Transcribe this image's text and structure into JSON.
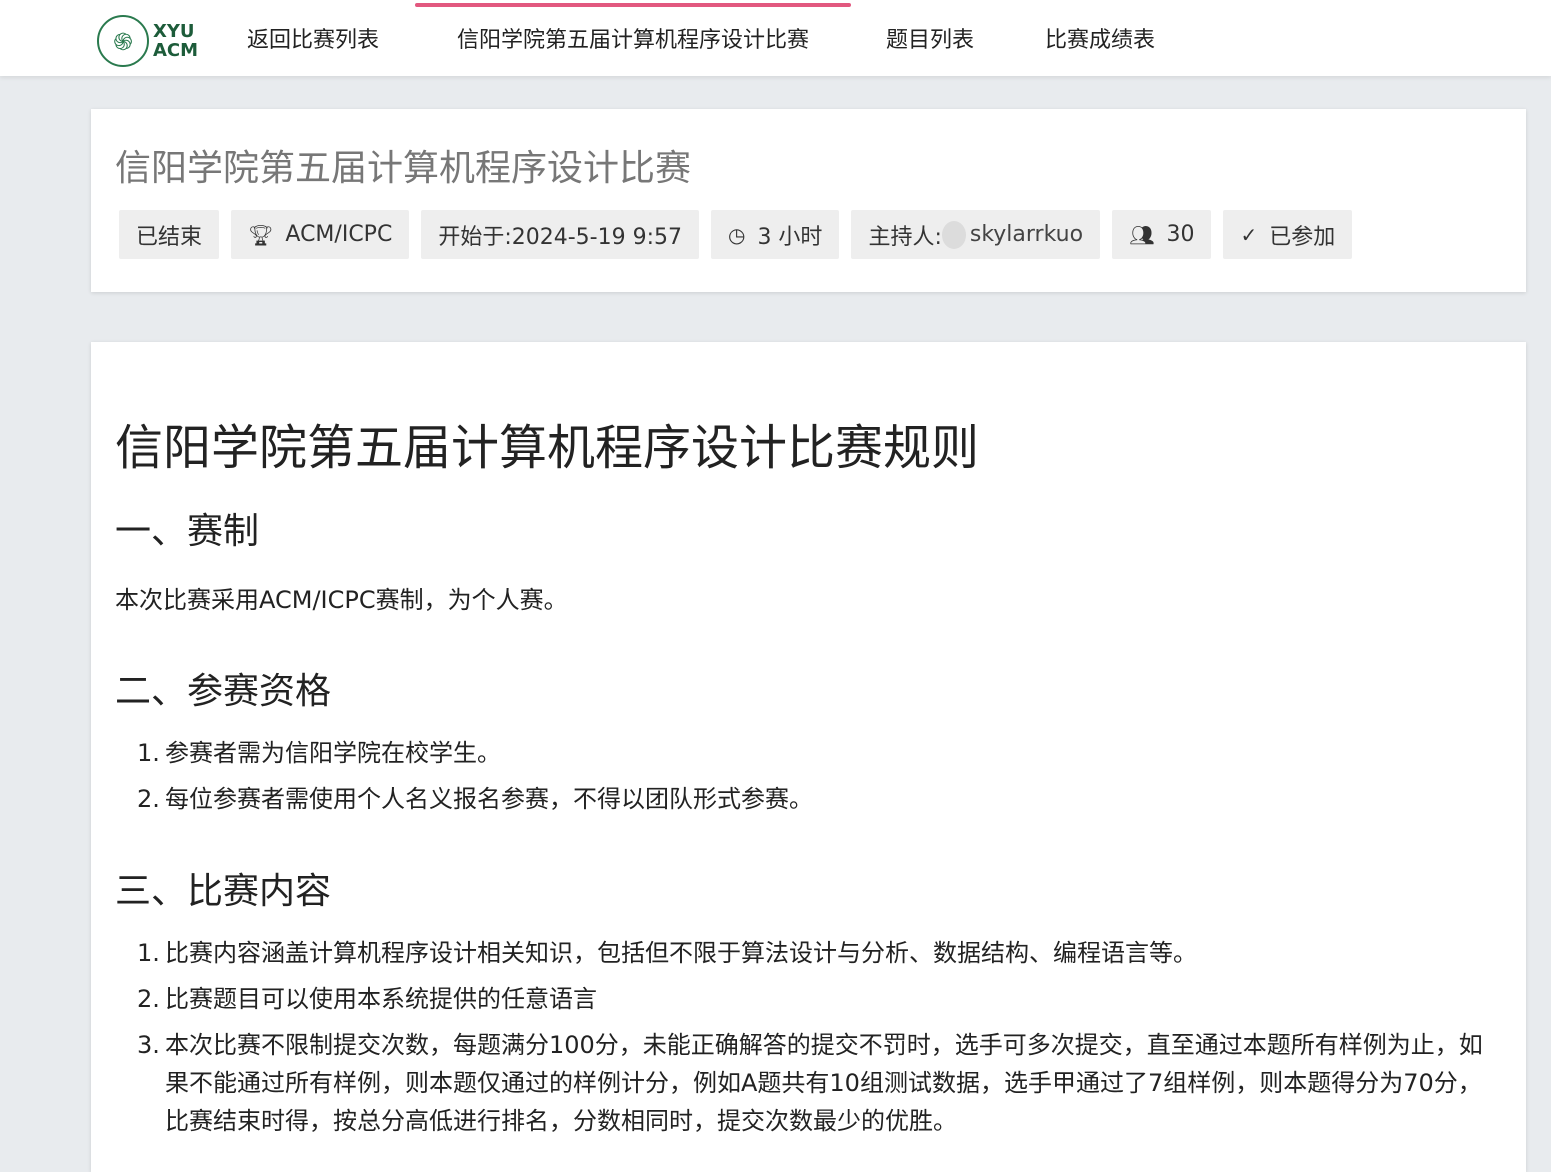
{
  "nav": {
    "logo_text_1": "XYU",
    "logo_text_2": "ACM",
    "items": [
      {
        "label": "返回比赛列表"
      },
      {
        "label": "信阳学院第五届计算机程序设计比赛"
      },
      {
        "label": "题目列表"
      },
      {
        "label": "比赛成绩表"
      }
    ],
    "active_color": "#e2587f"
  },
  "contest": {
    "title": "信阳学院第五届计算机程序设计比赛",
    "status": "已结束",
    "format_icon": "trophy-icon",
    "format": "ACM/ICPC",
    "start": "开始于:2024-5-19 9:57",
    "duration_icon": "clock-icon",
    "duration": "3 小时",
    "host_label": "主持人:",
    "host_name": "skylarrkuo",
    "participants_icon": "people-icon",
    "participants": "30",
    "joined_icon": "check-icon",
    "joined": "已参加"
  },
  "rules": {
    "title": "信阳学院第五届计算机程序设计比赛规则",
    "sections": [
      {
        "heading": "一、赛制",
        "text": "本次比赛采用ACM/ICPC赛制，为个人赛。"
      },
      {
        "heading": "二、参赛资格",
        "items": [
          "参赛者需为信阳学院在校学生。",
          "每位参赛者需使用个人名义报名参赛，不得以团队形式参赛。"
        ]
      },
      {
        "heading": "三、比赛内容",
        "items": [
          "比赛内容涵盖计算机程序设计相关知识，包括但不限于算法设计与分析、数据结构、编程语言等。",
          "比赛题目可以使用本系统提供的任意语言",
          "本次比赛不限制提交次数，每题满分100分，未能正确解答的提交不罚时，选手可多次提交，直至通过本题所有样例为止，如果不能通过所有样例，则本题仅通过的样例计分，例如A题共有10组测试数据，选手甲通过了7组样例，则本题得分为70分，比赛结束时得，按总分高低进行排名，分数相同时，提交次数最少的优胜。"
        ]
      }
    ]
  }
}
